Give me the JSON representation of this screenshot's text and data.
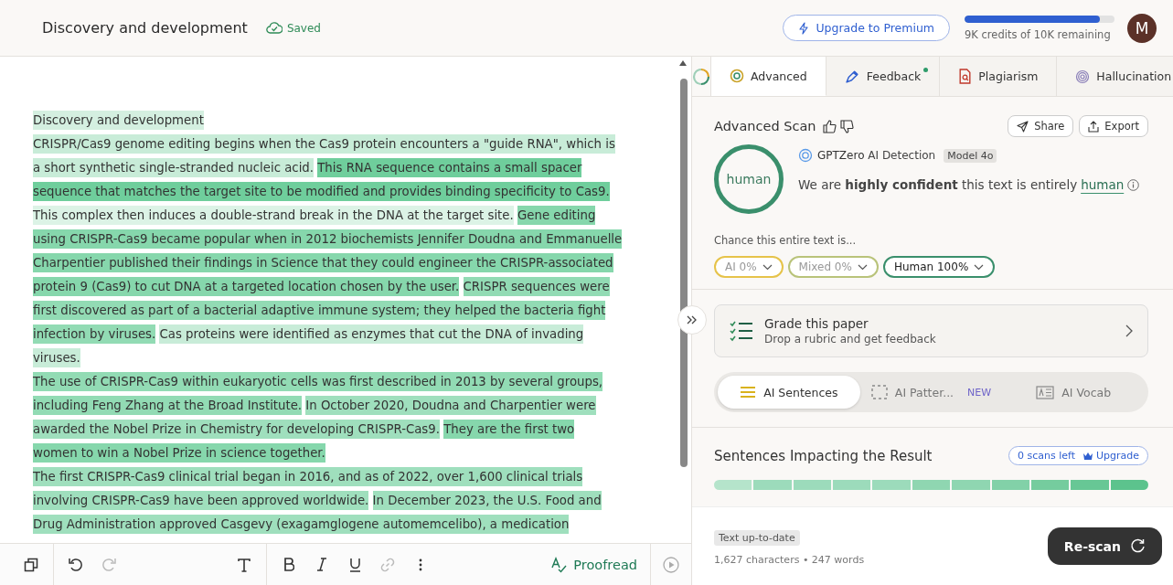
{
  "header": {
    "doc_title": "Discovery and development",
    "save_status": "Saved",
    "upgrade_button": "Upgrade to Premium",
    "credits": {
      "level": 0.9,
      "text": "9K credits of 10K remaining"
    },
    "avatar": "M"
  },
  "document": {
    "lines": [
      {
        "segments": [
          {
            "text": "Discovery and development",
            "color": "#d4efe0"
          }
        ]
      },
      {
        "segments": [
          {
            "text": "CRISPR/Cas9 genome editing begins when the Cas9 protein encounters a \"guide RNA\", which is",
            "color": "#c8ecd8"
          }
        ]
      },
      {
        "segments": [
          {
            "text": "a short synthetic single-stranded nucleic acid.",
            "color": "#c8ecd8"
          },
          {
            "text": "This RNA sequence contains a small spacer",
            "color": "#6fce9c"
          }
        ]
      },
      {
        "segments": [
          {
            "text": "sequence that matches the target site to be modified and provides binding specificity to Cas9.",
            "color": "#6fce9c"
          }
        ]
      },
      {
        "segments": [
          {
            "text": "This complex then induces a double-strand break in the DNA at the target site.",
            "color": "#dcf3e6"
          },
          {
            "text": "Gene editing",
            "color": "#86d7ac"
          }
        ]
      },
      {
        "segments": [
          {
            "text": "using CRISPR-Cas9 became popular when in 2012 biochemists Jennifer Doudna and Emmanuelle",
            "color": "#86d7ac"
          }
        ]
      },
      {
        "segments": [
          {
            "text": "Charpentier published their findings in Science that they could engineer the CRISPR-associated",
            "color": "#86d7ac"
          }
        ]
      },
      {
        "segments": [
          {
            "text": "protein 9 (Cas9) to cut DNA at a targeted location chosen by the user.",
            "color": "#86d7ac"
          },
          {
            "text": "CRISPR sequences were",
            "color": "#92dbb4"
          }
        ]
      },
      {
        "segments": [
          {
            "text": "first discovered as part of a bacterial adaptive immune system; they helped the bacteria fight",
            "color": "#92dbb4"
          }
        ]
      },
      {
        "segments": [
          {
            "text": "infection by viruses.",
            "color": "#92dbb4"
          },
          {
            "text": "Cas proteins were identified as enzymes that cut the DNA of invading",
            "color": "#c8ecd8"
          }
        ]
      },
      {
        "segments": [
          {
            "text": "viruses.",
            "color": "#c8ecd8"
          }
        ]
      },
      {
        "segments": [
          {
            "text": "The use of CRISPR-Cas9 within eukaryotic cells was first described in 2013 by several groups,",
            "color": "#92dbb4"
          }
        ]
      },
      {
        "segments": [
          {
            "text": "including Feng Zhang at the Broad Institute.",
            "color": "#92dbb4"
          },
          {
            "text": "In October 2020, Doudna and Charpentier were",
            "color": "#9fdfbd"
          }
        ]
      },
      {
        "segments": [
          {
            "text": "awarded the Nobel Prize in Chemistry for developing CRISPR-Cas9.",
            "color": "#9fdfbd"
          },
          {
            "text": "They are the first two",
            "color": "#86d7ac"
          }
        ]
      },
      {
        "segments": [
          {
            "text": "women to win a Nobel Prize in science together.",
            "color": "#86d7ac"
          }
        ]
      },
      {
        "segments": [
          {
            "text": "The first CRISPR-Cas9 clinical trial began in 2016, and as of 2022, over 1,600 clinical trials",
            "color": "#9fdfbd"
          }
        ]
      },
      {
        "segments": [
          {
            "text": "involving CRISPR-Cas9 have been approved worldwide.",
            "color": "#9fdfbd"
          },
          {
            "text": "In December 2023, the U.S. Food and",
            "color": "#9fdfbd"
          }
        ]
      },
      {
        "segments": [
          {
            "text": "Drug Administration approved Casgevy (exagamglogene automemcelibo), a medication",
            "color": "#9fdfbd"
          }
        ]
      }
    ]
  },
  "toolbar": {
    "proofread": "Proofread"
  },
  "panel": {
    "tabs": [
      {
        "label": "Advanced",
        "kind": "advanced",
        "selected": true,
        "dot": false
      },
      {
        "label": "Feedback",
        "kind": "feedback",
        "selected": false,
        "dot": true
      },
      {
        "label": "Plagiarism",
        "kind": "plagiarism",
        "selected": false,
        "dot": false
      },
      {
        "label": "Hallucination",
        "kind": "hallucination",
        "selected": false,
        "dot": false
      }
    ],
    "scan": {
      "title": "Advanced Scan",
      "share": "Share",
      "export": "Export",
      "result": "human",
      "product": "GPTZero",
      "product_suffix": "AI Detection",
      "model_badge": "Model 4o",
      "verdict": "We are **highly confident** this text is entirely",
      "verdict_link": "human",
      "chance_label": "Chance this entire text is...",
      "pills": [
        {
          "label": "AI 0%",
          "color": "#e6c34a",
          "selected": false
        },
        {
          "label": "Mixed 0%",
          "color": "#b9c37a",
          "selected": false
        },
        {
          "label": "Human 100%",
          "color": "#3a8f6c",
          "selected": true
        }
      ]
    },
    "grade": {
      "title": "Grade this paper",
      "subtitle": "Drop a rubric and get feedback"
    },
    "views": [
      {
        "label": "AI Sentences",
        "kind": "sentences",
        "selected": true
      },
      {
        "label": "AI Patter...",
        "kind": "patterns",
        "selected": false,
        "badge": "NEW"
      },
      {
        "label": "AI Vocab",
        "kind": "vocab",
        "selected": false
      }
    ],
    "impact": {
      "title": "Sentences Impacting the Result",
      "scans_left": "0 scans left",
      "upgrade": "Upgrade"
    },
    "footer": {
      "status": "Text up-to-date",
      "counts": "1,627 characters • 247 words",
      "rescan": "Re-scan"
    }
  }
}
